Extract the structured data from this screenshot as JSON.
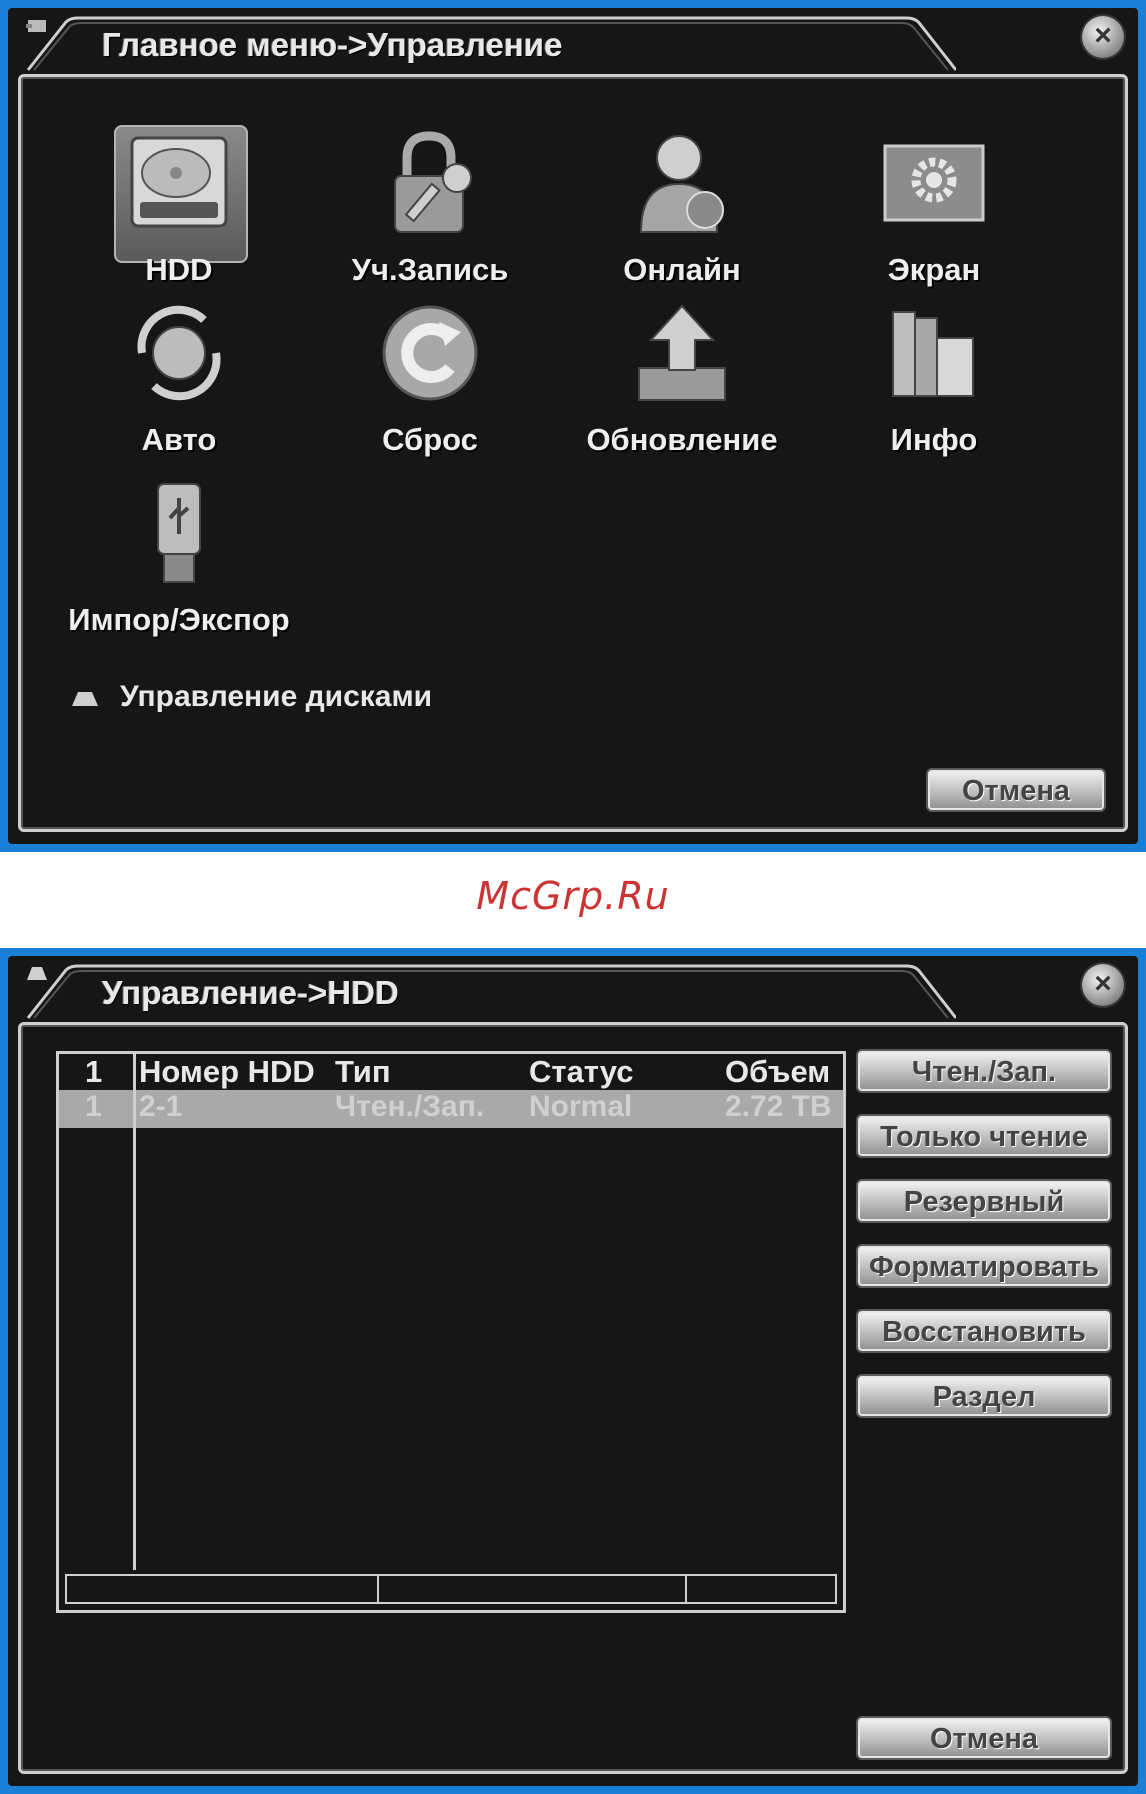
{
  "menu": {
    "title": "Главное меню->Управление",
    "items": [
      {
        "label": "HDD",
        "icon": "hdd-icon"
      },
      {
        "label": "Уч.Запись",
        "icon": "lock-key-icon"
      },
      {
        "label": "Онлайн",
        "icon": "online-user-icon"
      },
      {
        "label": "Экран",
        "icon": "screen-gear-icon"
      },
      {
        "label": "Авто",
        "icon": "auto-globe-icon"
      },
      {
        "label": "Сброс",
        "icon": "reset-icon"
      },
      {
        "label": "Обновление",
        "icon": "upgrade-arrow-icon"
      },
      {
        "label": "Инфо",
        "icon": "info-books-icon"
      },
      {
        "label": "Импор/Экспор",
        "icon": "usb-icon"
      }
    ],
    "status_text": "Управление дисками",
    "cancel_label": "Отмена"
  },
  "watermark": "McGrp.Ru",
  "hdd": {
    "title": "Управление->HDD",
    "columns": {
      "num": "1",
      "hdd_number": "Номер HDD",
      "type": "Тип",
      "status": "Статус",
      "size": "Объем"
    },
    "rows": [
      {
        "num": "1",
        "hdd_number": "2-1",
        "type": "Чтен./Зап.",
        "status": "Normal",
        "size": "2.72 TB"
      }
    ],
    "buttons": {
      "read_write": "Чтен./Зап.",
      "read_only": "Только чтение",
      "redundant": "Резервный",
      "format": "Форматировать",
      "recover": "Восстановить",
      "partition": "Раздел"
    },
    "cancel_label": "Отмена"
  },
  "colors": {
    "panel_bg": "#1a7fd6",
    "screen_bg": "#161616",
    "watermark": "#cc3333"
  }
}
